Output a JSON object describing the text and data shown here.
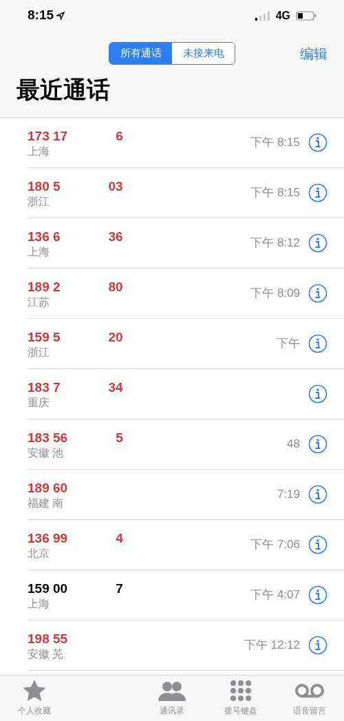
{
  "status_bar": {
    "time": "8:15",
    "network": "4G"
  },
  "segments": [
    {
      "label": "所有通话",
      "selected": true
    },
    {
      "label": "未接来电",
      "selected": false
    }
  ],
  "edit": "编辑",
  "title": "最近通话",
  "calls": [
    {
      "number_head": "173 17",
      "number_tail": "6",
      "location": "上海",
      "time": "下午 8:15",
      "missed": true
    },
    {
      "number_head": "180 5",
      "number_tail": "03",
      "location": "浙江",
      "time": "下午 8:15",
      "missed": true
    },
    {
      "number_head": "136 6",
      "number_tail": "36",
      "location": "上海",
      "time": "下午 8:12",
      "missed": true
    },
    {
      "number_head": "189 2",
      "number_tail": "80",
      "location": "江苏",
      "time": "下午 8:09",
      "missed": true
    },
    {
      "number_head": "159 5",
      "number_tail": "20",
      "location": "浙江",
      "time": "下午",
      "missed": true
    },
    {
      "number_head": "183 7",
      "number_tail": "34",
      "location": "重庆",
      "missed": true
    },
    {
      "number_head": "183 56",
      "number_tail": "5",
      "location": "安徽 池",
      "time": "48",
      "missed": true
    },
    {
      "number_head": "189 60",
      "location": "福建 南",
      "time": "7:19",
      "missed": true
    },
    {
      "number_head": "136 99",
      "number_tail": "4",
      "location": "北京",
      "time": "下午 7:06",
      "missed": true
    },
    {
      "number_head": "159 00",
      "number_tail": "7",
      "location": "上海",
      "time": "下午 4:07",
      "missed": false
    },
    {
      "number_head": "198 55",
      "location": "安徽 芜",
      "time": "下午 12:12",
      "missed": true
    }
  ],
  "tabs": [
    {
      "kind": "star",
      "label": "个人收藏"
    },
    {
      "kind": "hidden"
    },
    {
      "kind": "contacts",
      "label": "通讯录"
    },
    {
      "kind": "keypad",
      "label": "拨号键盘"
    },
    {
      "kind": "voicemail",
      "label": "语音留言"
    }
  ]
}
